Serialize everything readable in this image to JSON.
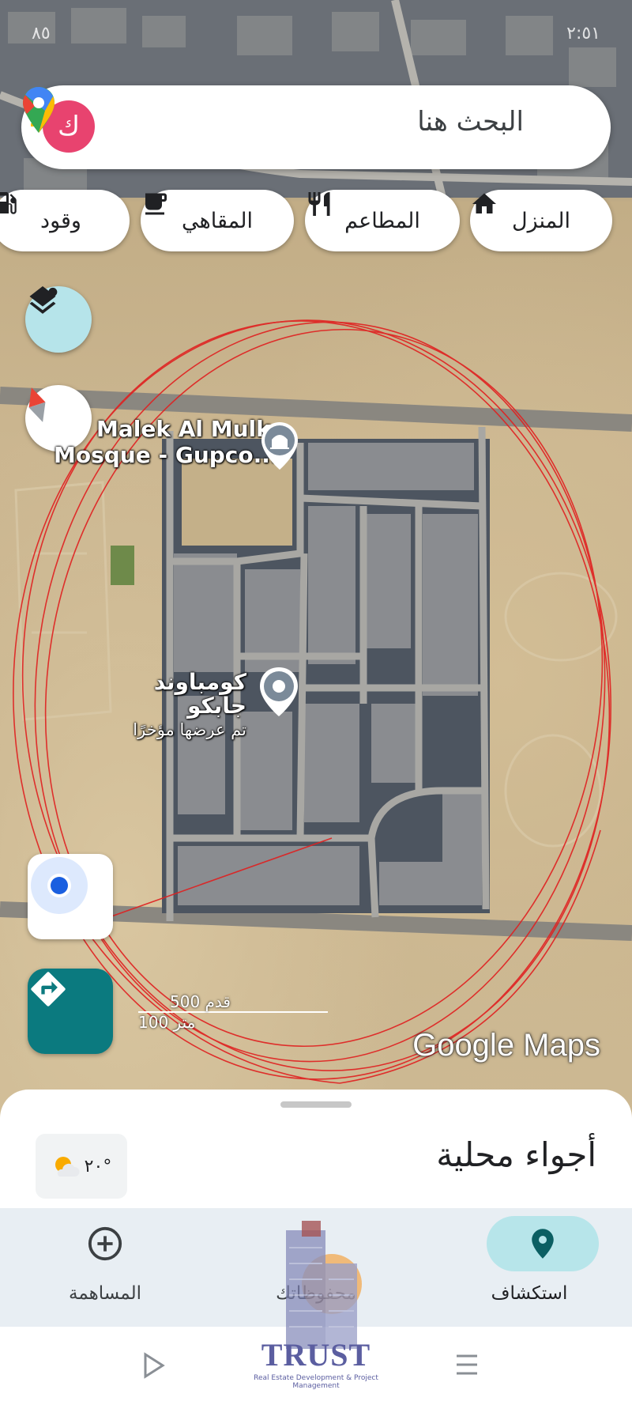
{
  "status_bar": {
    "left": "٨٥",
    "right": "٢:٥١"
  },
  "search": {
    "placeholder": "البحث هنا",
    "avatar_letter": "ك",
    "mic_icon": "mic-icon",
    "logo_icon": "google-maps-pin-icon"
  },
  "chips": [
    {
      "label": "المنزل",
      "icon": "home-icon"
    },
    {
      "label": "المطاعم",
      "icon": "restaurant-icon"
    },
    {
      "label": "المقاهي",
      "icon": "coffee-icon"
    },
    {
      "label": "وقود",
      "icon": "gas-station-icon"
    }
  ],
  "map": {
    "places": [
      {
        "name_line1": "Malek Al Mulk",
        "name_line2": "Mosque - Gupco...",
        "icon": "mosque-pin-icon"
      },
      {
        "name_line1": "كومباوند جابكو",
        "name_line2": "تم عرضها مؤخرًا",
        "icon": "recent-pin-icon"
      }
    ],
    "scale_feet": "500 قدم",
    "scale_meters": "100 متر",
    "attribution": "Google Maps",
    "annotation_color": "#e02020"
  },
  "sheet": {
    "title": "أجواء محلية",
    "weather": "٢٠°"
  },
  "nav": [
    {
      "label": "استكشاف",
      "icon": "location-pin-icon",
      "active": true
    },
    {
      "label": "محفوظاتك",
      "icon": "bookmark-icon",
      "active": false
    },
    {
      "label": "المساهمة",
      "icon": "add-circle-icon",
      "active": false
    }
  ],
  "watermark": {
    "title": "TRUST",
    "subtitle": "Real Estate Development & Project Management"
  },
  "colors": {
    "accent": "#0b7a7f",
    "avatar": "#e8436f",
    "nav_active": "#b7e5ea"
  }
}
